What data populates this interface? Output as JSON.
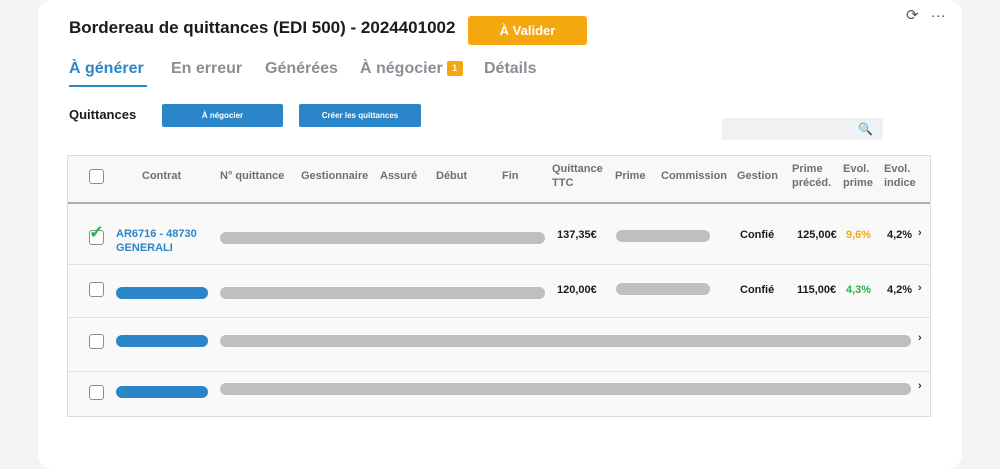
{
  "header": {
    "title": "Bordereau de quittances (EDI 500) - 2024401002",
    "validate_label": "À Valider",
    "refresh_icon": "⟳",
    "more_icon": "···"
  },
  "tabs": [
    {
      "label": "À générer",
      "active": true
    },
    {
      "label": "En erreur"
    },
    {
      "label": "Générées"
    },
    {
      "label": "À négocier",
      "badge": "1"
    },
    {
      "label": "Détails"
    }
  ],
  "section": {
    "label": "Quittances",
    "btn_negocier": "À négocier",
    "btn_creer": "Créer les quittances",
    "search_icon": "🔍"
  },
  "table": {
    "headers": {
      "contrat": "Contrat",
      "quittance": "N° quittance",
      "gestionnaire": "Gestionnaire",
      "assure": "Assuré",
      "debut": "Début",
      "fin": "Fin",
      "ttc_1": "Quittance",
      "ttc_2": "TTC",
      "prime": "Prime",
      "commission": "Commission",
      "gestion": "Gestion",
      "precedent_1": "Prime",
      "precedent_2": "précéd.",
      "evol_prime_1": "Evol.",
      "evol_prime_2": "prime",
      "evol_indice_1": "Evol.",
      "evol_indice_2": "indice"
    },
    "rows": [
      {
        "contrat_1": "AR6716 - 48730",
        "contrat_2": "GENERALI",
        "ttc": "137,35€",
        "gestion": "Confié",
        "precedent": "125,00€",
        "evol_prime": "9,6%",
        "evol_indice": "4,2%",
        "chevron": "›"
      },
      {
        "ttc": "120,00€",
        "gestion": "Confié",
        "precedent": "115,00€",
        "evol_prime": "4,3%",
        "evol_indice": "4,2%",
        "chevron": "›"
      },
      {
        "chevron": "›"
      },
      {
        "chevron": "›"
      }
    ]
  },
  "colors": {
    "accent": "#2a86c8",
    "warning": "#f5a70f",
    "positive": "#2bb24c"
  }
}
